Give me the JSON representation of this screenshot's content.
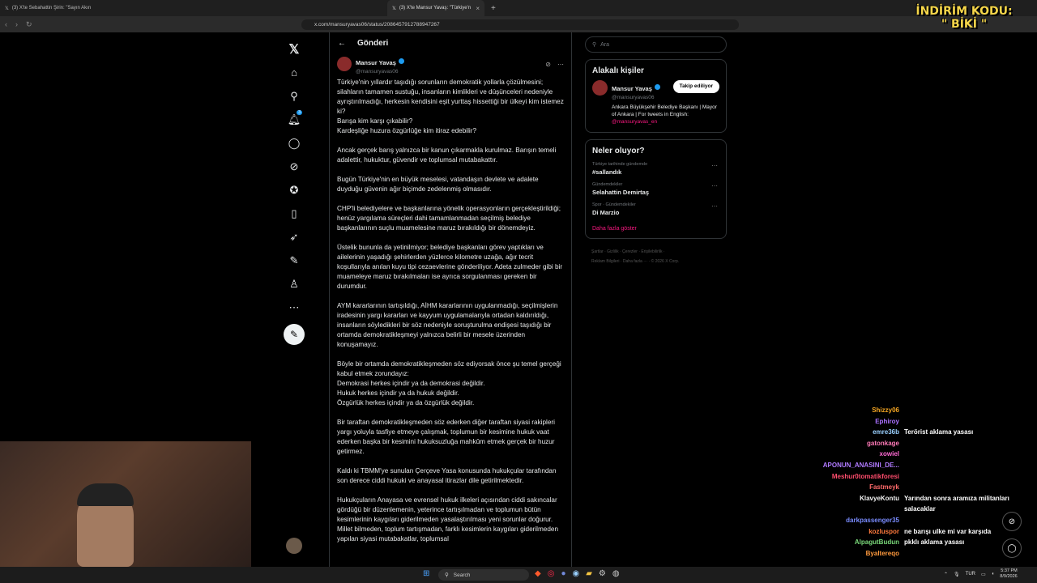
{
  "browser": {
    "tabs": [
      {
        "title": "(3) X'te Sebahattin Şirin: \"Sayın Akın"
      },
      {
        "title": "(3) X'te Mansur Yavaş: \"Türkiye'n"
      }
    ],
    "url": "x.com/mansuryavas06/status/2086457912788947267"
  },
  "promo": {
    "line1": "İNDİRİM KODU:",
    "line2": "\" BİKİ \""
  },
  "header": {
    "title": "Gönderi"
  },
  "author": {
    "name": "Mansur Yavaş",
    "handle": "@mansuryavas06"
  },
  "post_paragraphs": [
    "Türkiye'nin yıllardır taşıdığı sorunların demokratik yollarla çözülmesini; silahların tamamen sustuğu, insanların kimlikleri ve düşünceleri nedeniyle ayrıştırılmadığı, herkesin kendisini eşit yurttaş hissettiği bir ülkeyi kim istemez ki?\nBarışa kim karşı çıkabilir?\nKardeşliğe huzura özgürlüğe kim itiraz edebilir?",
    "Ancak gerçek barış yalnızca bir kanun çıkarmakla kurulmaz. Barışın temeli adalettir, hukuktur, güvendir ve toplumsal mutabakattır.",
    "Bugün Türkiye'nin en büyük meselesi, vatandaşın devlete ve adalete duyduğu güvenin ağır biçimde zedelenmiş olmasıdır.",
    "CHP'li belediyelere ve başkanlarına yönelik operasyonların gerçekleştirildiği; henüz yargılama süreçleri dahi tamamlanmadan seçilmiş belediye başkanlarının suçlu muamelesine maruz bırakıldığı bir dönemdeyiz.",
    "Üstelik bununla da yetinilmiyor; belediye başkanları görev yaptıkları ve ailelerinin yaşadığı şehirlerden yüzlerce kilometre uzağa, ağır tecrit koşullarıyla anılan kuyu tipi cezaevlerine gönderiliyor. Adeta zulmeder gibi bir muameleye maruz bırakılmaları ise ayrıca sorgulanması gereken bir durumdur.",
    "AYM kararlarının tartışıldığı, AİHM kararlarının uygulanmadığı, seçilmişlerin iradesinin yargı kararları ve kayyum uygulamalarıyla ortadan kaldırıldığı, insanların söyledikleri bir söz nedeniyle soruşturulma endişesi taşıdığı bir ortamda demokratikleşmeyi yalnızca belirli bir mesele üzerinden konuşamayız.",
    "Böyle bir ortamda demokratikleşmeden söz ediyorsak önce şu temel gerçeği kabul etmek zorundayız:\nDemokrasi herkes içindir ya da demokrasi değildir.\nHukuk herkes içindir ya da hukuk değildir.\nÖzgürlük herkes içindir ya da özgürlük değildir.",
    "Bir taraftan demokratikleşmeden söz ederken diğer taraftan siyasi rakipleri yargı yoluyla tasfiye etmeye çalışmak, toplumun bir kesimine hukuk vaat ederken başka bir kesimini hukuksuzluğa mahkûm etmek gerçek bir huzur getirmez.",
    "Kaldı ki TBMM'ye sunulan Çerçeve Yasa konusunda hukukçular tarafından son derece ciddi hukuki ve anayasal itirazlar dile getirilmektedir.",
    "Hukukçuların Anayasa ve evrensel hukuk ilkeleri açısından ciddi sakıncalar gördüğü bir düzenlemenin, yeterince tartışılmadan ve toplumun bütün kesimlerinin kaygıları giderilmeden yasalaştırılması yeni sorunlar doğurur. Millet bilmeden, toplum tartışmadan, farklı kesimlerin kaygıları giderilmeden yapılan siyasi mutabakatlar, toplumsal"
  ],
  "search": {
    "placeholder": "Ara"
  },
  "related": {
    "title": "Alakalı kişiler",
    "name": "Mansur Yavaş",
    "handle": "@mansuryavas06",
    "follow_label": "Takip ediliyor",
    "bio": "Ankara Büyükşehir Belediye Başkanı | Mayor of Ankara | For tweets in English:",
    "bio_link": "@mansuryavas_en"
  },
  "trends": {
    "title": "Neler oluyor?",
    "items": [
      {
        "context": "Türkiye tarihinde gündemde",
        "topic": "#sallandık"
      },
      {
        "context": "Gündemdekiler",
        "topic": "Selahattin Demirtaş"
      },
      {
        "context": "Spor · Gündemdekiler",
        "topic": "Di Marzio"
      }
    ],
    "show_more": "Daha fazla göster"
  },
  "footer": {
    "line1": "Şartlar  ·  Gizlilik  ·  Çerezler  ·  Erişilebilirlik  ·",
    "line2": "Reklam Bilgileri  ·  Daha fazla ···  ·  © 2026 X Corp."
  },
  "chat": [
    {
      "user": "Shizzy06",
      "color": "#f5a623",
      "msg": ""
    },
    {
      "user": "Ephiroy",
      "color": "#a970ff",
      "msg": ""
    },
    {
      "user": "emre36b",
      "color": "#9ad0ff",
      "msg": "Terörist aklama yasası"
    },
    {
      "user": "gatonkage",
      "color": "#ff7ab8",
      "msg": ""
    },
    {
      "user": "xowiel",
      "color": "#ff6ad5",
      "msg": ""
    },
    {
      "user": "APONUN_ANASINI_DE...",
      "color": "#b07aff",
      "msg": ""
    },
    {
      "user": "Meshur0tomatikforesi",
      "color": "#ff4d6d",
      "msg": ""
    },
    {
      "user": "Fastmeyk",
      "color": "#ff6a6a",
      "msg": ""
    },
    {
      "user": "KlavyeKontu",
      "color": "#f3f3f3",
      "msg": "Yarından sonra aramıza militanları"
    },
    {
      "user": "",
      "color": "#f3f3f3",
      "msg": "salacaklar"
    },
    {
      "user": "darkpassenger35",
      "color": "#7a8cff",
      "msg": ""
    },
    {
      "user": "kozluspor",
      "color": "#ff7a3d",
      "msg": "ne barışı ulke mi var karşıda"
    },
    {
      "user": "AlpagutBudun",
      "color": "#7ad97a",
      "msg": "pkklı aklama yasası"
    },
    {
      "user": "Byaltereqo",
      "color": "#ff9a3d",
      "msg": ""
    }
  ],
  "taskbar": {
    "search": "Search",
    "lang": "TUR",
    "time": "5:37 PM",
    "date": "8/9/2026"
  }
}
